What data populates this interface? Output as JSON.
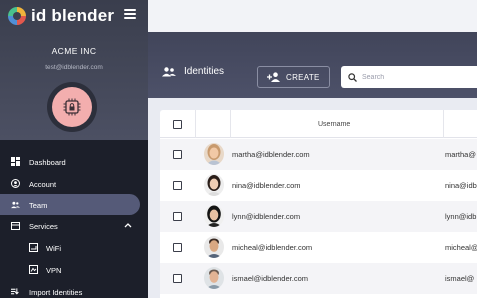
{
  "brand": {
    "name": "id blender"
  },
  "account": {
    "org": "ACME INC",
    "email": "test@idblender.com"
  },
  "nav": {
    "dashboard": "Dashboard",
    "account": "Account",
    "team": "Team",
    "services": "Services",
    "wifi": "WiFi",
    "vpn": "VPN",
    "import": "Import Identities"
  },
  "page": {
    "title": "Identities",
    "create_label": "CREATE",
    "search_placeholder": "Search"
  },
  "table": {
    "columns": [
      "Username"
    ],
    "rows": [
      {
        "username": "martha@idblender.com",
        "second": "martha@",
        "alt": true
      },
      {
        "username": "nina@idblender.com",
        "second": "nina@idb",
        "alt": false
      },
      {
        "username": "lynn@idblender.com",
        "second": "lynn@idb",
        "alt": true
      },
      {
        "username": "micheal@idblender.com",
        "second": "micheal@",
        "alt": false
      },
      {
        "username": "ismael@idblender.com",
        "second": "ismael@",
        "alt": true
      }
    ]
  },
  "colors": {
    "sidebar": "#1c1f2a",
    "banner": "#41455a",
    "active": "#555a78",
    "avatar": "#f3aeae"
  }
}
